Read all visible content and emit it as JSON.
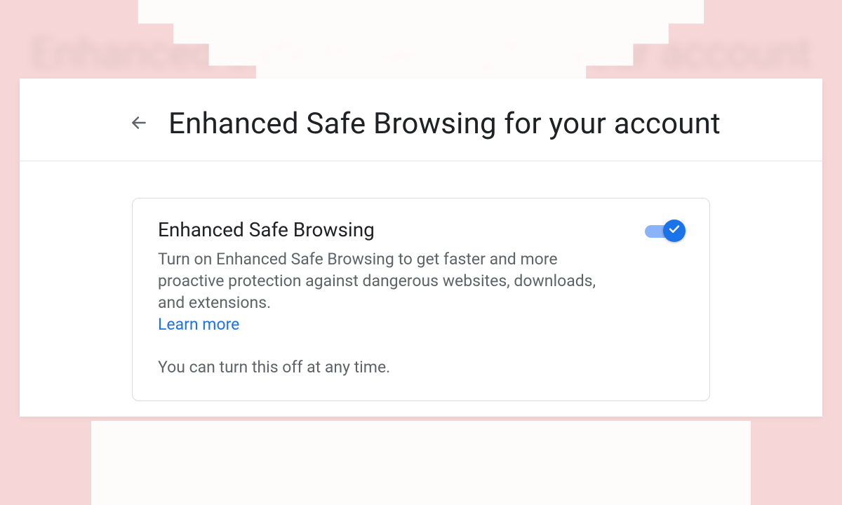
{
  "ghost_text": "Enhanced Safe Browsing for your account",
  "header": {
    "title": "Enhanced Safe Browsing for your account"
  },
  "card": {
    "title": "Enhanced Safe Browsing",
    "description": "Turn on Enhanced Safe Browsing to get faster and more proactive protection against dangerous websites, downloads, and extensions.",
    "learn_more": "Learn more",
    "note": "You can turn this off at any time.",
    "toggle_on": true
  },
  "colors": {
    "accent": "#1a73e8",
    "accent_light": "#8ab4f8",
    "bg": "#f6d6d6",
    "text_primary": "#202124",
    "text_secondary": "#5f6368",
    "border": "#dadce0"
  }
}
